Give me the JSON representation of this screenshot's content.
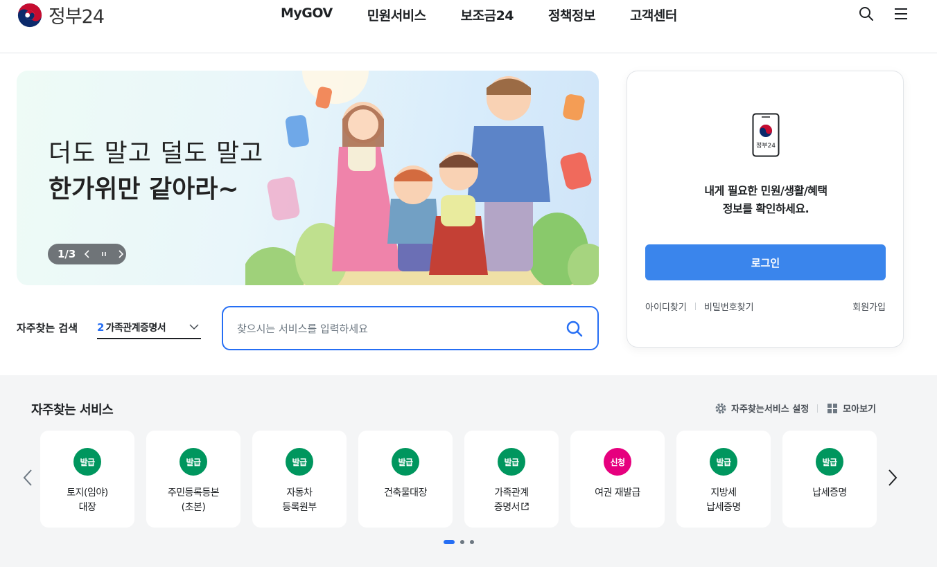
{
  "header": {
    "logo_text": "정부24",
    "nav": [
      "MyGOV",
      "민원서비스",
      "보조금24",
      "정책정보",
      "고객센터"
    ]
  },
  "banner": {
    "title_line1": "더도 말고 덜도 말고",
    "title_line2": "한가위만 같아라~",
    "counter": "1/3"
  },
  "favorite_search": {
    "label": "자주찾는 검색",
    "rank": "2",
    "term": "가족관계증명서"
  },
  "search": {
    "placeholder": "찾으시는 서비스를 입력하세요"
  },
  "login": {
    "phone_label": "정부24",
    "message_line1": "내게 필요한 민원/생활/혜택",
    "message_line2": "정보를 확인하세요.",
    "button": "로그인",
    "find_id": "아이디찾기",
    "find_pw": "비밀번호찾기",
    "signup": "회원가입"
  },
  "services": {
    "title": "자주찾는 서비스",
    "settings": "자주찾는서비스 설정",
    "view_all": "모아보기",
    "colors": {
      "issue": "#00965e",
      "apply": "#e6007e",
      "accent": "#256ef4"
    },
    "items": [
      {
        "badge": "발급",
        "type": "issue",
        "label": "토지(임야)\n대장"
      },
      {
        "badge": "발급",
        "type": "issue",
        "label": "주민등록등본\n(초본)"
      },
      {
        "badge": "발급",
        "type": "issue",
        "label": "자동차\n등록원부"
      },
      {
        "badge": "발급",
        "type": "issue",
        "label": "건축물대장"
      },
      {
        "badge": "발급",
        "type": "issue",
        "label": "가족관계\n증명서",
        "external": true
      },
      {
        "badge": "신청",
        "type": "apply",
        "label": "여권 재발급"
      },
      {
        "badge": "발급",
        "type": "issue",
        "label": "지방세\n납세증명"
      },
      {
        "badge": "발급",
        "type": "issue",
        "label": "납세증명"
      }
    ],
    "pages": 3,
    "current_page": 1
  }
}
